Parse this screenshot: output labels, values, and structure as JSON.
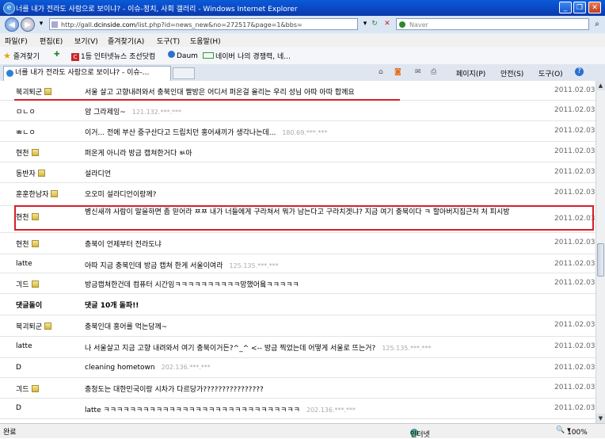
{
  "window": {
    "title": "너를 내가 전라도 사람으로 보이냐? - 이슈-정치, 사회 갤러리 - Windows Internet Explorer",
    "minimize": "_",
    "restore": "❐",
    "close": "✕"
  },
  "address": {
    "url_prefix": "http://gall.",
    "url_domain": "dcinside.com",
    "url_rest": "/list.php?id=news_new&no=272517&page=1&bbs=",
    "search_placeholder": "Naver"
  },
  "menu": [
    "파일(F)",
    "편집(E)",
    "보기(V)",
    "즐겨찾기(A)",
    "도구(T)",
    "도움말(H)"
  ],
  "favorites": {
    "label": "즐겨찾기",
    "items": [
      "1등 인터넷뉴스 조선닷컴",
      "Daum",
      "네이버",
      "나의 경쟁력, 네..."
    ]
  },
  "tab": {
    "title": "너를 내가 전라도 사람으로 보이냐? - 이슈-..."
  },
  "command_bar": {
    "page": "페이지(P)",
    "safety": "안전(S)",
    "tools": "도구(O)",
    "help": "?"
  },
  "comments": [
    {
      "nick": "북괴퇴군",
      "icon": true,
      "text": "서울 살고 고향내려와서 충북인대 짤방은 어디서 퍼온걸 올리는 우리 성님 아따 아따 합께요",
      "ip": "",
      "date": "2011.02.03"
    },
    {
      "nick": "ㅁㄴㅇ",
      "icon": false,
      "text": "암 그라제잉~",
      "ip": "121.132.***.***",
      "date": "2011.02.03"
    },
    {
      "nick": "ㅃㄴㅇ",
      "icon": false,
      "text": "이거... 전에 부산 중구산다고 드립치던 홍어새끼가 생각나는데...",
      "ip": "180.69.***.***",
      "date": "2011.02.03"
    },
    {
      "nick": "현천",
      "icon": true,
      "text": "퍼온게 아니라 방금 캡쳐한거다 ㅄ아",
      "ip": "",
      "date": "2011.02.03"
    },
    {
      "nick": "동반자",
      "icon": true,
      "text": "설라디언",
      "ip": "",
      "date": "2011.02.03"
    },
    {
      "nick": "훈훈한남자",
      "icon": true,
      "text": "오오미 설라디언이랑께?",
      "ip": "",
      "date": "2011.02.03"
    },
    {
      "nick": "현천",
      "icon": true,
      "text": "병신새꺄 사람이 말을하면 좀 믿어라 ㅉㅉ 내가 너들에게 구라쳐서 뭐가 남는다고 구라치겟냐? 지금 여기 충북이다 ㅋ 할아버지집근처 처 피시방",
      "ip": "",
      "date": "2011.02.03"
    },
    {
      "nick": "현천",
      "icon": true,
      "text": "충북이 언제부터 전라도냐",
      "ip": "",
      "date": "2011.02.03"
    },
    {
      "nick": "latte",
      "icon": false,
      "text": "아따 지금 충북인데 방금 캡쳐 한게 서울이여라",
      "ip": "125.135.***.***",
      "date": "2011.02.03"
    },
    {
      "nick": "긔드",
      "icon": true,
      "text": "방금캡쳐한건데 컴퓨터 시간임ㅋㅋㅋㅋㅋㅋㅋㅋㅋㅋ망했어욬ㅋㅋㅋㅋㅋ",
      "ip": "",
      "date": "2011.02.03"
    },
    {
      "nick": "댓글돌이",
      "icon": false,
      "text": "댓글 10개 돌파!!",
      "ip": "",
      "date": ""
    },
    {
      "nick": "북괴퇴군",
      "icon": true,
      "text": "충북인대 홍어를 먹는당께~",
      "ip": "",
      "date": "2011.02.03"
    },
    {
      "nick": "latte",
      "icon": false,
      "text": "나 서울살고 지금 고향 내려와서 여기 충북이거든?^_^ <-- 방금 찍었는데 어떻게 서울로 뜨는거?",
      "ip": "125.135.***.***",
      "date": "2011.02.03"
    },
    {
      "nick": "D",
      "icon": false,
      "text": "cleaning hometown",
      "ip": "202.136.***.***",
      "date": "2011.02.03"
    },
    {
      "nick": "긔드",
      "icon": true,
      "text": "충청도는 대한민국이랑 시차가 다르당가????????????????",
      "ip": "",
      "date": "2011.02.03"
    },
    {
      "nick": "D",
      "icon": false,
      "text": "latte ㅋㅋㅋㅋㅋㅋㅋㅋㅋㅋㅋㅋㅋㅋㅋㅋㅋㅋㅋㅋㅋㅋㅋㅋㅋㅋㅋㅋㅋㅋ",
      "ip": "202.136.***.***",
      "date": "2011.02.03"
    }
  ],
  "status": {
    "left": "완료",
    "zone": "인터넷",
    "zoom": "100%"
  }
}
